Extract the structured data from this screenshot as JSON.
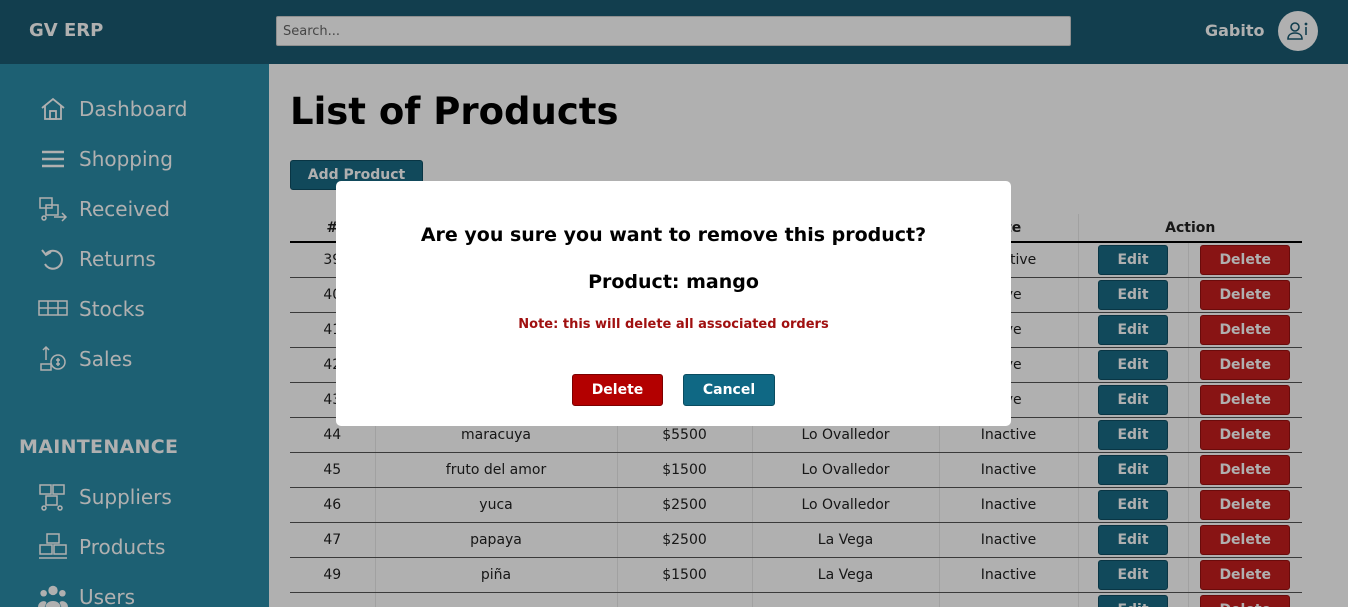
{
  "app": {
    "brand": "GV ERP"
  },
  "header": {
    "search_placeholder": "Search...",
    "username": "Gabito",
    "avatar_icon": "user-info-icon"
  },
  "sidebar": {
    "items": [
      {
        "label": "Dashboard",
        "icon": "home-icon"
      },
      {
        "label": "Shopping",
        "icon": "menu-lines-icon"
      },
      {
        "label": "Received",
        "icon": "received-icon"
      },
      {
        "label": "Returns",
        "icon": "undo-icon"
      },
      {
        "label": "Stocks",
        "icon": "stocks-icon"
      },
      {
        "label": "Sales",
        "icon": "sales-icon"
      }
    ],
    "maintenance_title": "MAINTENANCE",
    "maintenance_items": [
      {
        "label": "Suppliers",
        "icon": "suppliers-icon"
      },
      {
        "label": "Products",
        "icon": "products-icon"
      },
      {
        "label": "Users",
        "icon": "users-icon"
      }
    ]
  },
  "main": {
    "title": "List of Products",
    "add_button": "Add Product",
    "table": {
      "headers": [
        "#",
        "",
        "",
        "",
        "ate",
        "Action"
      ],
      "edit_label": "Edit",
      "delete_label": "Delete",
      "rows": [
        {
          "id": "39",
          "name": "",
          "price": "",
          "location": "",
          "state": "Inactive"
        },
        {
          "id": "40",
          "name": "",
          "price": "",
          "location": "",
          "state": "tive"
        },
        {
          "id": "41",
          "name": "",
          "price": "",
          "location": "",
          "state": "tive"
        },
        {
          "id": "42",
          "name": "",
          "price": "",
          "location": "",
          "state": "tive"
        },
        {
          "id": "43",
          "name": "",
          "price": "",
          "location": "",
          "state": "tive"
        },
        {
          "id": "44",
          "name": "maracuya",
          "price": "$5500",
          "location": "Lo Ovalledor",
          "state": "Inactive"
        },
        {
          "id": "45",
          "name": "fruto del amor",
          "price": "$1500",
          "location": "Lo Ovalledor",
          "state": "Inactive"
        },
        {
          "id": "46",
          "name": "yuca",
          "price": "$2500",
          "location": "Lo Ovalledor",
          "state": "Inactive"
        },
        {
          "id": "47",
          "name": "papaya",
          "price": "$2500",
          "location": "La Vega",
          "state": "Inactive"
        },
        {
          "id": "49",
          "name": "piña",
          "price": "$1500",
          "location": "La Vega",
          "state": "Inactive"
        },
        {
          "id": "",
          "name": "",
          "price": "",
          "location": "",
          "state": ""
        }
      ]
    }
  },
  "modal": {
    "question": "Are you sure you want to remove this product?",
    "product_line": "Product: mango",
    "note": "Note: this will delete all associated orders",
    "delete_label": "Delete",
    "cancel_label": "Cancel"
  },
  "colors": {
    "topbar": "#1b5b71",
    "sidebar": "#2a8ca7",
    "primary_button": "#1a6b85",
    "danger_button": "#c61d1d",
    "note_text": "#a01010"
  }
}
